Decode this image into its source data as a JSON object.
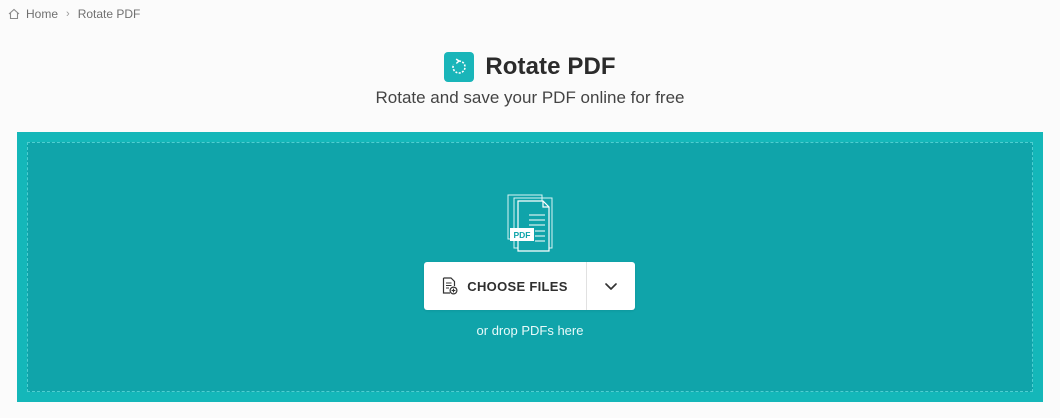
{
  "breadcrumb": {
    "home_label": "Home",
    "current_label": "Rotate PDF",
    "separator": "›"
  },
  "header": {
    "title": "Rotate PDF",
    "subtitle": "Rotate and save your PDF online for free",
    "icon": "rotate-icon"
  },
  "dropzone": {
    "illustration_icon": "pdf-files-icon",
    "illustration_text": "PDF",
    "choose_files_label": "CHOOSE FILES",
    "choose_icon": "add-file-icon",
    "dropdown_icon": "chevron-down-icon",
    "hint": "or drop PDFs here"
  },
  "colors": {
    "accent": "#19b5b9",
    "dropzone_outer": "#14b7b9",
    "dropzone_inner": "#10a4aa"
  }
}
